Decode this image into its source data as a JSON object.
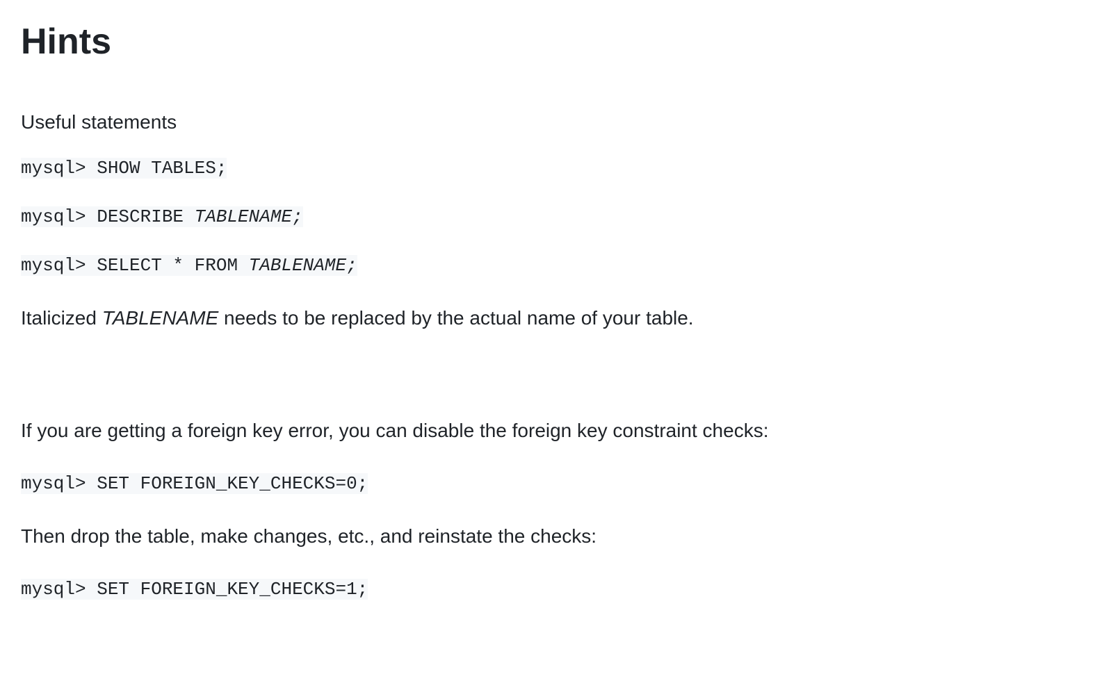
{
  "heading": "Hints",
  "section1": {
    "subheading": "Useful statements",
    "code1_prefix": "mysql> SHOW TABLES;",
    "code2_prefix": "mysql> DESCRIBE ",
    "code2_italic": "TABLENAME;",
    "code3_prefix": "mysql> SELECT * FROM ",
    "code3_italic": "TABLENAME;",
    "note_prefix": "Italicized ",
    "note_italic": "TABLENAME",
    "note_suffix": " needs to be replaced by the actual name of your table."
  },
  "section2": {
    "para1": "If you are getting a foreign key error, you can disable the foreign key constraint checks:",
    "code1": "mysql> SET FOREIGN_KEY_CHECKS=0;",
    "para2": "Then drop the table, make changes, etc., and reinstate the checks:",
    "code2": "mysql> SET FOREIGN_KEY_CHECKS=1;"
  }
}
